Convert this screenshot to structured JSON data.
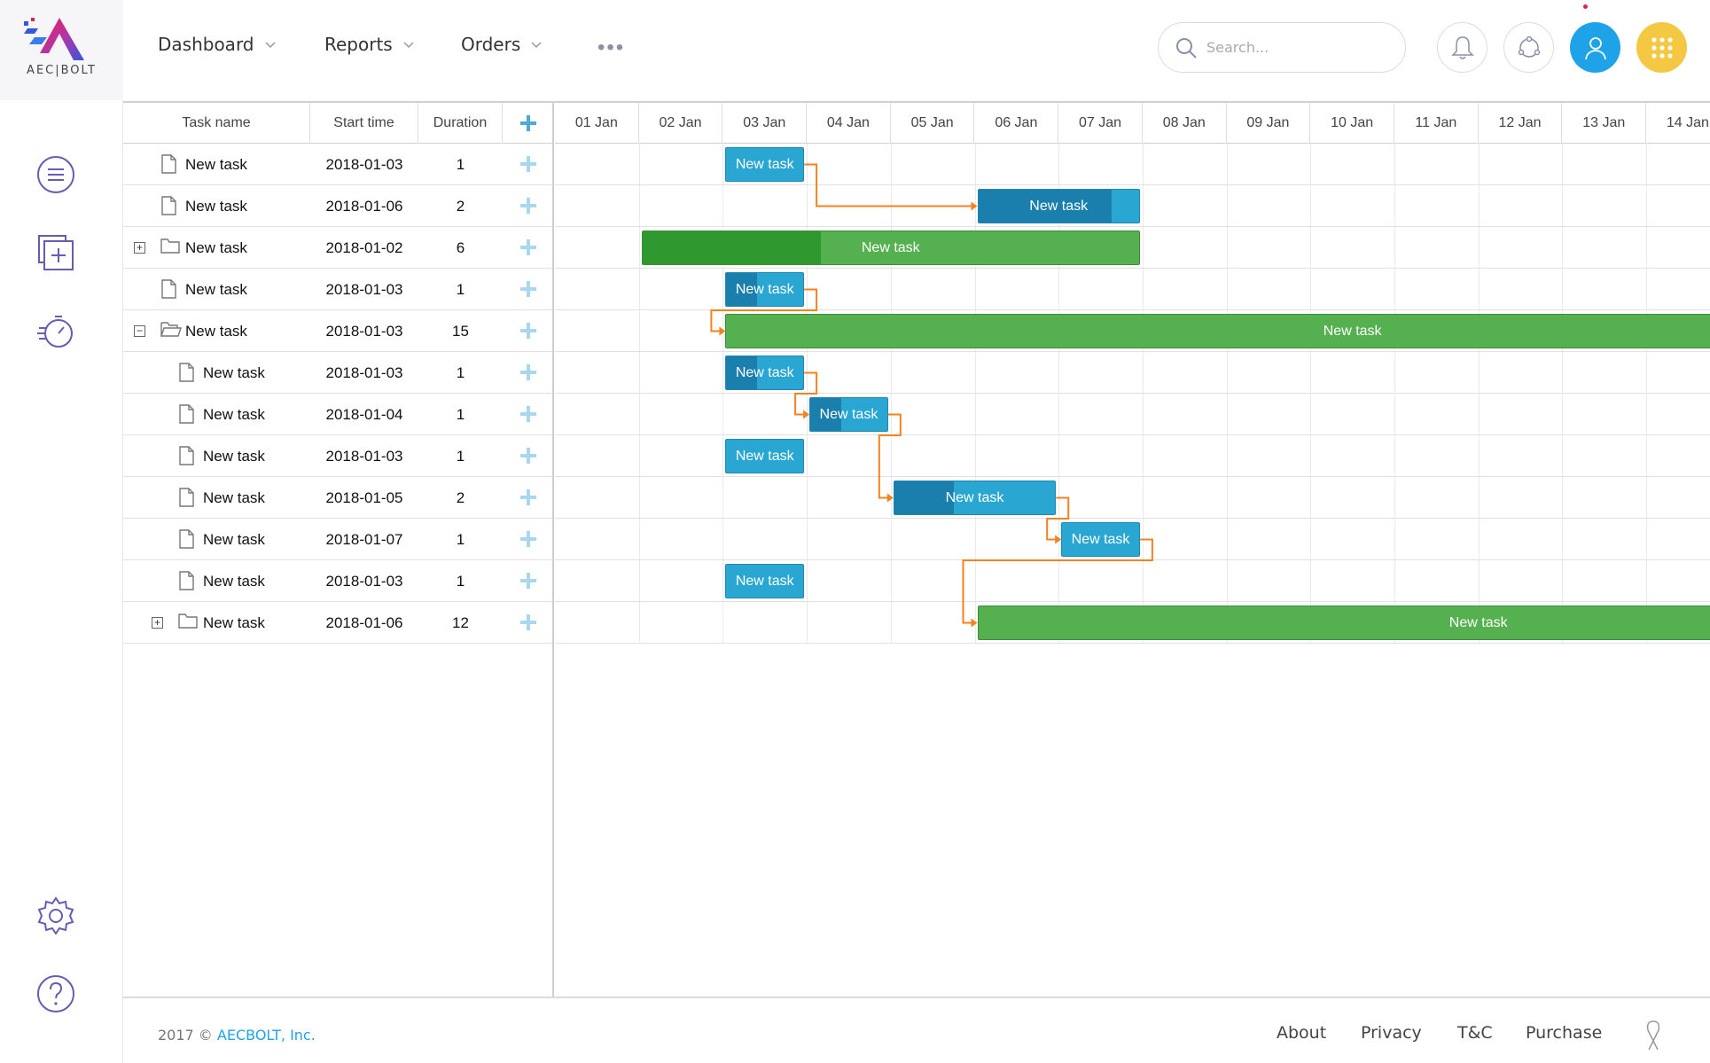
{
  "app": {
    "logo_text": "AEC|BOLT"
  },
  "nav": {
    "dashboard": "Dashboard",
    "reports": "Reports",
    "orders": "Orders",
    "more": "•••"
  },
  "search": {
    "placeholder": "Search..."
  },
  "gantt": {
    "columns": {
      "task_name": "Task name",
      "start_time": "Start time",
      "duration": "Duration"
    },
    "days": [
      "01 Jan",
      "02 Jan",
      "03 Jan",
      "04 Jan",
      "05 Jan",
      "06 Jan",
      "07 Jan",
      "08 Jan",
      "09 Jan",
      "10 Jan",
      "11 Jan",
      "12 Jan",
      "13 Jan",
      "14 Jan"
    ],
    "rows": [
      {
        "name": "New task",
        "start": "2018-01-03",
        "duration": "1",
        "type": "file",
        "level": 0,
        "bar_label": "New task",
        "progress": 0
      },
      {
        "name": "New task",
        "start": "2018-01-06",
        "duration": "2",
        "type": "file",
        "level": 0,
        "bar_label": "New task",
        "progress": 0.83
      },
      {
        "name": "New task",
        "start": "2018-01-02",
        "duration": "6",
        "type": "folder",
        "toggle": "+",
        "level": 0,
        "bar_label": "New task",
        "progress": 0.36
      },
      {
        "name": "New task",
        "start": "2018-01-03",
        "duration": "1",
        "type": "file",
        "level": 0,
        "bar_label": "New task",
        "progress": 0.4
      },
      {
        "name": "New task",
        "start": "2018-01-03",
        "duration": "15",
        "type": "folder-open",
        "toggle": "−",
        "level": 0,
        "bar_label": "New task",
        "progress": 0
      },
      {
        "name": "New task",
        "start": "2018-01-03",
        "duration": "1",
        "type": "file",
        "level": 1,
        "bar_label": "New task",
        "progress": 0.4
      },
      {
        "name": "New task",
        "start": "2018-01-04",
        "duration": "1",
        "type": "file",
        "level": 1,
        "bar_label": "New task",
        "progress": 0.4
      },
      {
        "name": "New task",
        "start": "2018-01-03",
        "duration": "1",
        "type": "file",
        "level": 1,
        "bar_label": "New task",
        "progress": 0
      },
      {
        "name": "New task",
        "start": "2018-01-05",
        "duration": "2",
        "type": "file",
        "level": 1,
        "bar_label": "New task",
        "progress": 0.37
      },
      {
        "name": "New task",
        "start": "2018-01-07",
        "duration": "1",
        "type": "file",
        "level": 1,
        "bar_label": "New task",
        "progress": 0
      },
      {
        "name": "New task",
        "start": "2018-01-03",
        "duration": "1",
        "type": "file",
        "level": 1,
        "bar_label": "New task",
        "progress": 0
      },
      {
        "name": "New task",
        "start": "2018-01-06",
        "duration": "12",
        "type": "folder",
        "toggle": "+",
        "level": 1,
        "bar_label": "New task",
        "progress": 0
      }
    ]
  },
  "footer": {
    "copyright_prefix": "2017 © ",
    "brand": "AECBOLT, Inc.",
    "about": "About",
    "privacy": "Privacy",
    "tc": "T&C",
    "purchase": "Purchase"
  },
  "colors": {
    "accent_blue": "#1fa3e8",
    "accent_yellow": "#f4c842",
    "link_orange": "#f58220",
    "project_green": "#55b04f",
    "task_blue": "#2aa6d2"
  }
}
